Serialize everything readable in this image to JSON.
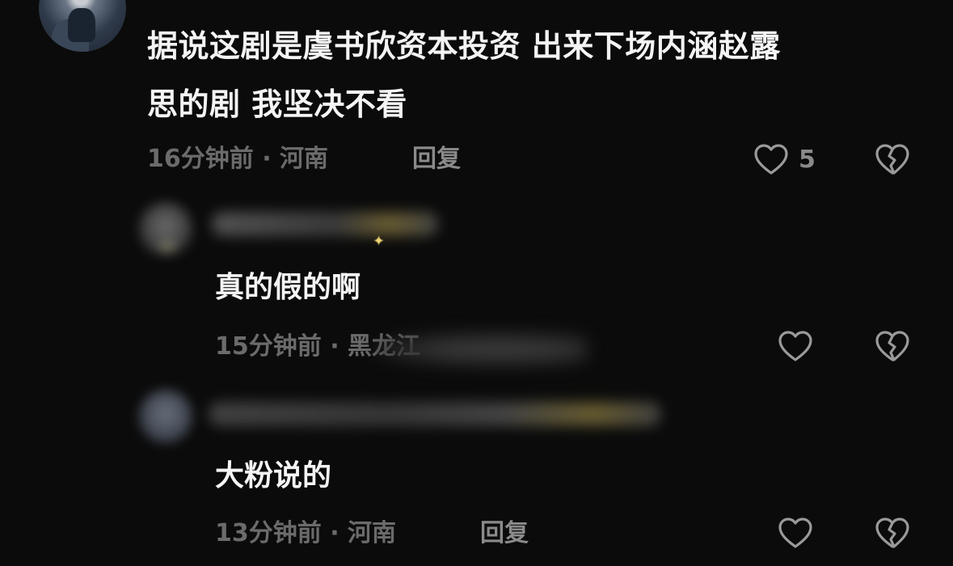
{
  "comments": {
    "main": {
      "text_line1": "据说这剧是虞书欣资本投资 出来下场内涵赵露",
      "text_line2": "思的剧 我坚决不看",
      "meta": "16分钟前 · 河南",
      "reply_label": "回复",
      "like_count": "5"
    },
    "reply1": {
      "text": "真的假的啊",
      "meta_visible": "15分钟前 · 黑龙江"
    },
    "reply2": {
      "text": "大粉说的",
      "meta": "13分钟前 · 河南",
      "reply_label": "回复"
    }
  },
  "icons": {
    "like": "heart-outline-icon",
    "dislike": "broken-heart-icon"
  },
  "colors": {
    "background": "#0b0b0b",
    "text": "#f4f4f4",
    "meta": "#6b6b6b",
    "icon": "#9a9a9a"
  }
}
